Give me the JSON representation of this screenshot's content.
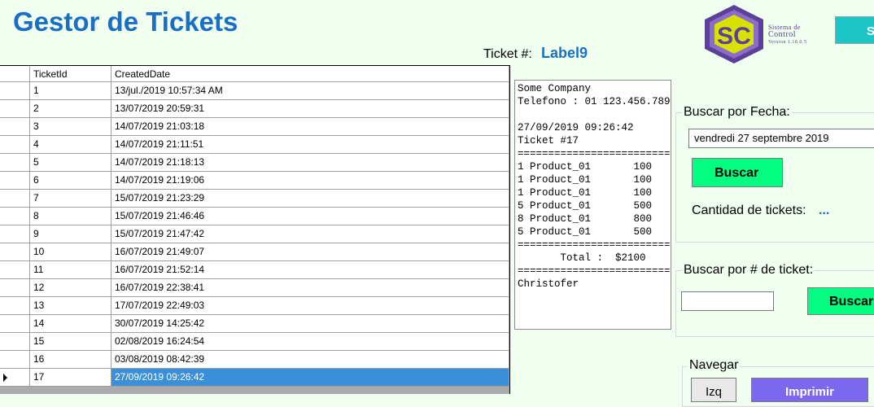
{
  "app": {
    "title": "Gestor de Tickets",
    "logo_letters": "SC",
    "logo_lines": [
      "Sistema de",
      "Control",
      "Version 1.18.0.5"
    ],
    "top_button_label": "S"
  },
  "ticket": {
    "label": "Ticket #:",
    "value": "Label9"
  },
  "grid": {
    "columns": [
      "TicketId",
      "CreatedDate"
    ],
    "rows": [
      {
        "id": "1",
        "date": "13/jul./2019 10:57:34 AM"
      },
      {
        "id": "2",
        "date": "13/07/2019 20:59:31"
      },
      {
        "id": "3",
        "date": "14/07/2019 21:03:18"
      },
      {
        "id": "4",
        "date": "14/07/2019 21:11:51"
      },
      {
        "id": "5",
        "date": "14/07/2019 21:18:13"
      },
      {
        "id": "6",
        "date": "14/07/2019 21:19:06"
      },
      {
        "id": "7",
        "date": "15/07/2019 21:23:29"
      },
      {
        "id": "8",
        "date": "15/07/2019 21:46:46"
      },
      {
        "id": "9",
        "date": "15/07/2019 21:47:42"
      },
      {
        "id": "10",
        "date": "16/07/2019 21:49:07"
      },
      {
        "id": "11",
        "date": "16/07/2019 21:52:14"
      },
      {
        "id": "12",
        "date": "16/07/2019 22:38:41"
      },
      {
        "id": "13",
        "date": "17/07/2019 22:49:03"
      },
      {
        "id": "14",
        "date": "30/07/2019 14:25:42"
      },
      {
        "id": "15",
        "date": "02/08/2019 16:24:54"
      },
      {
        "id": "16",
        "date": "03/08/2019 08:42:39"
      },
      {
        "id": "17",
        "date": "27/09/2019 09:26:42"
      }
    ],
    "selected_index": 16
  },
  "receipt": {
    "text": "Some Company\nTelefono : 01 123.456.789\n\n27/09/2019 09:26:42\nTicket #17\n==========================\n1 Product_01       100\n1 Product_01       100\n1 Product_01       100\n5 Product_01       500\n8 Product_01       800\n5 Product_01       500\n==========================\n       Total :  $2100\n==========================\nChristofer"
  },
  "search_date": {
    "group_label": "Buscar por Fecha:",
    "date_value": "vendredi  27 septembre 2019",
    "button_label": "Buscar",
    "count_label": "Cantidad de tickets:",
    "count_value": "..."
  },
  "search_number": {
    "group_label": "Buscar por # de ticket:",
    "input_value": "",
    "button_label": "Buscar"
  },
  "navigate": {
    "group_label": "Navegar",
    "prev_label": "Izq",
    "print_label": "Imprimir"
  },
  "colors": {
    "title": "#1a6fc4",
    "background": "#f0fff0",
    "green_button": "#00ff80",
    "print_button": "#7b68ee",
    "selection": "#3b8fd8"
  }
}
